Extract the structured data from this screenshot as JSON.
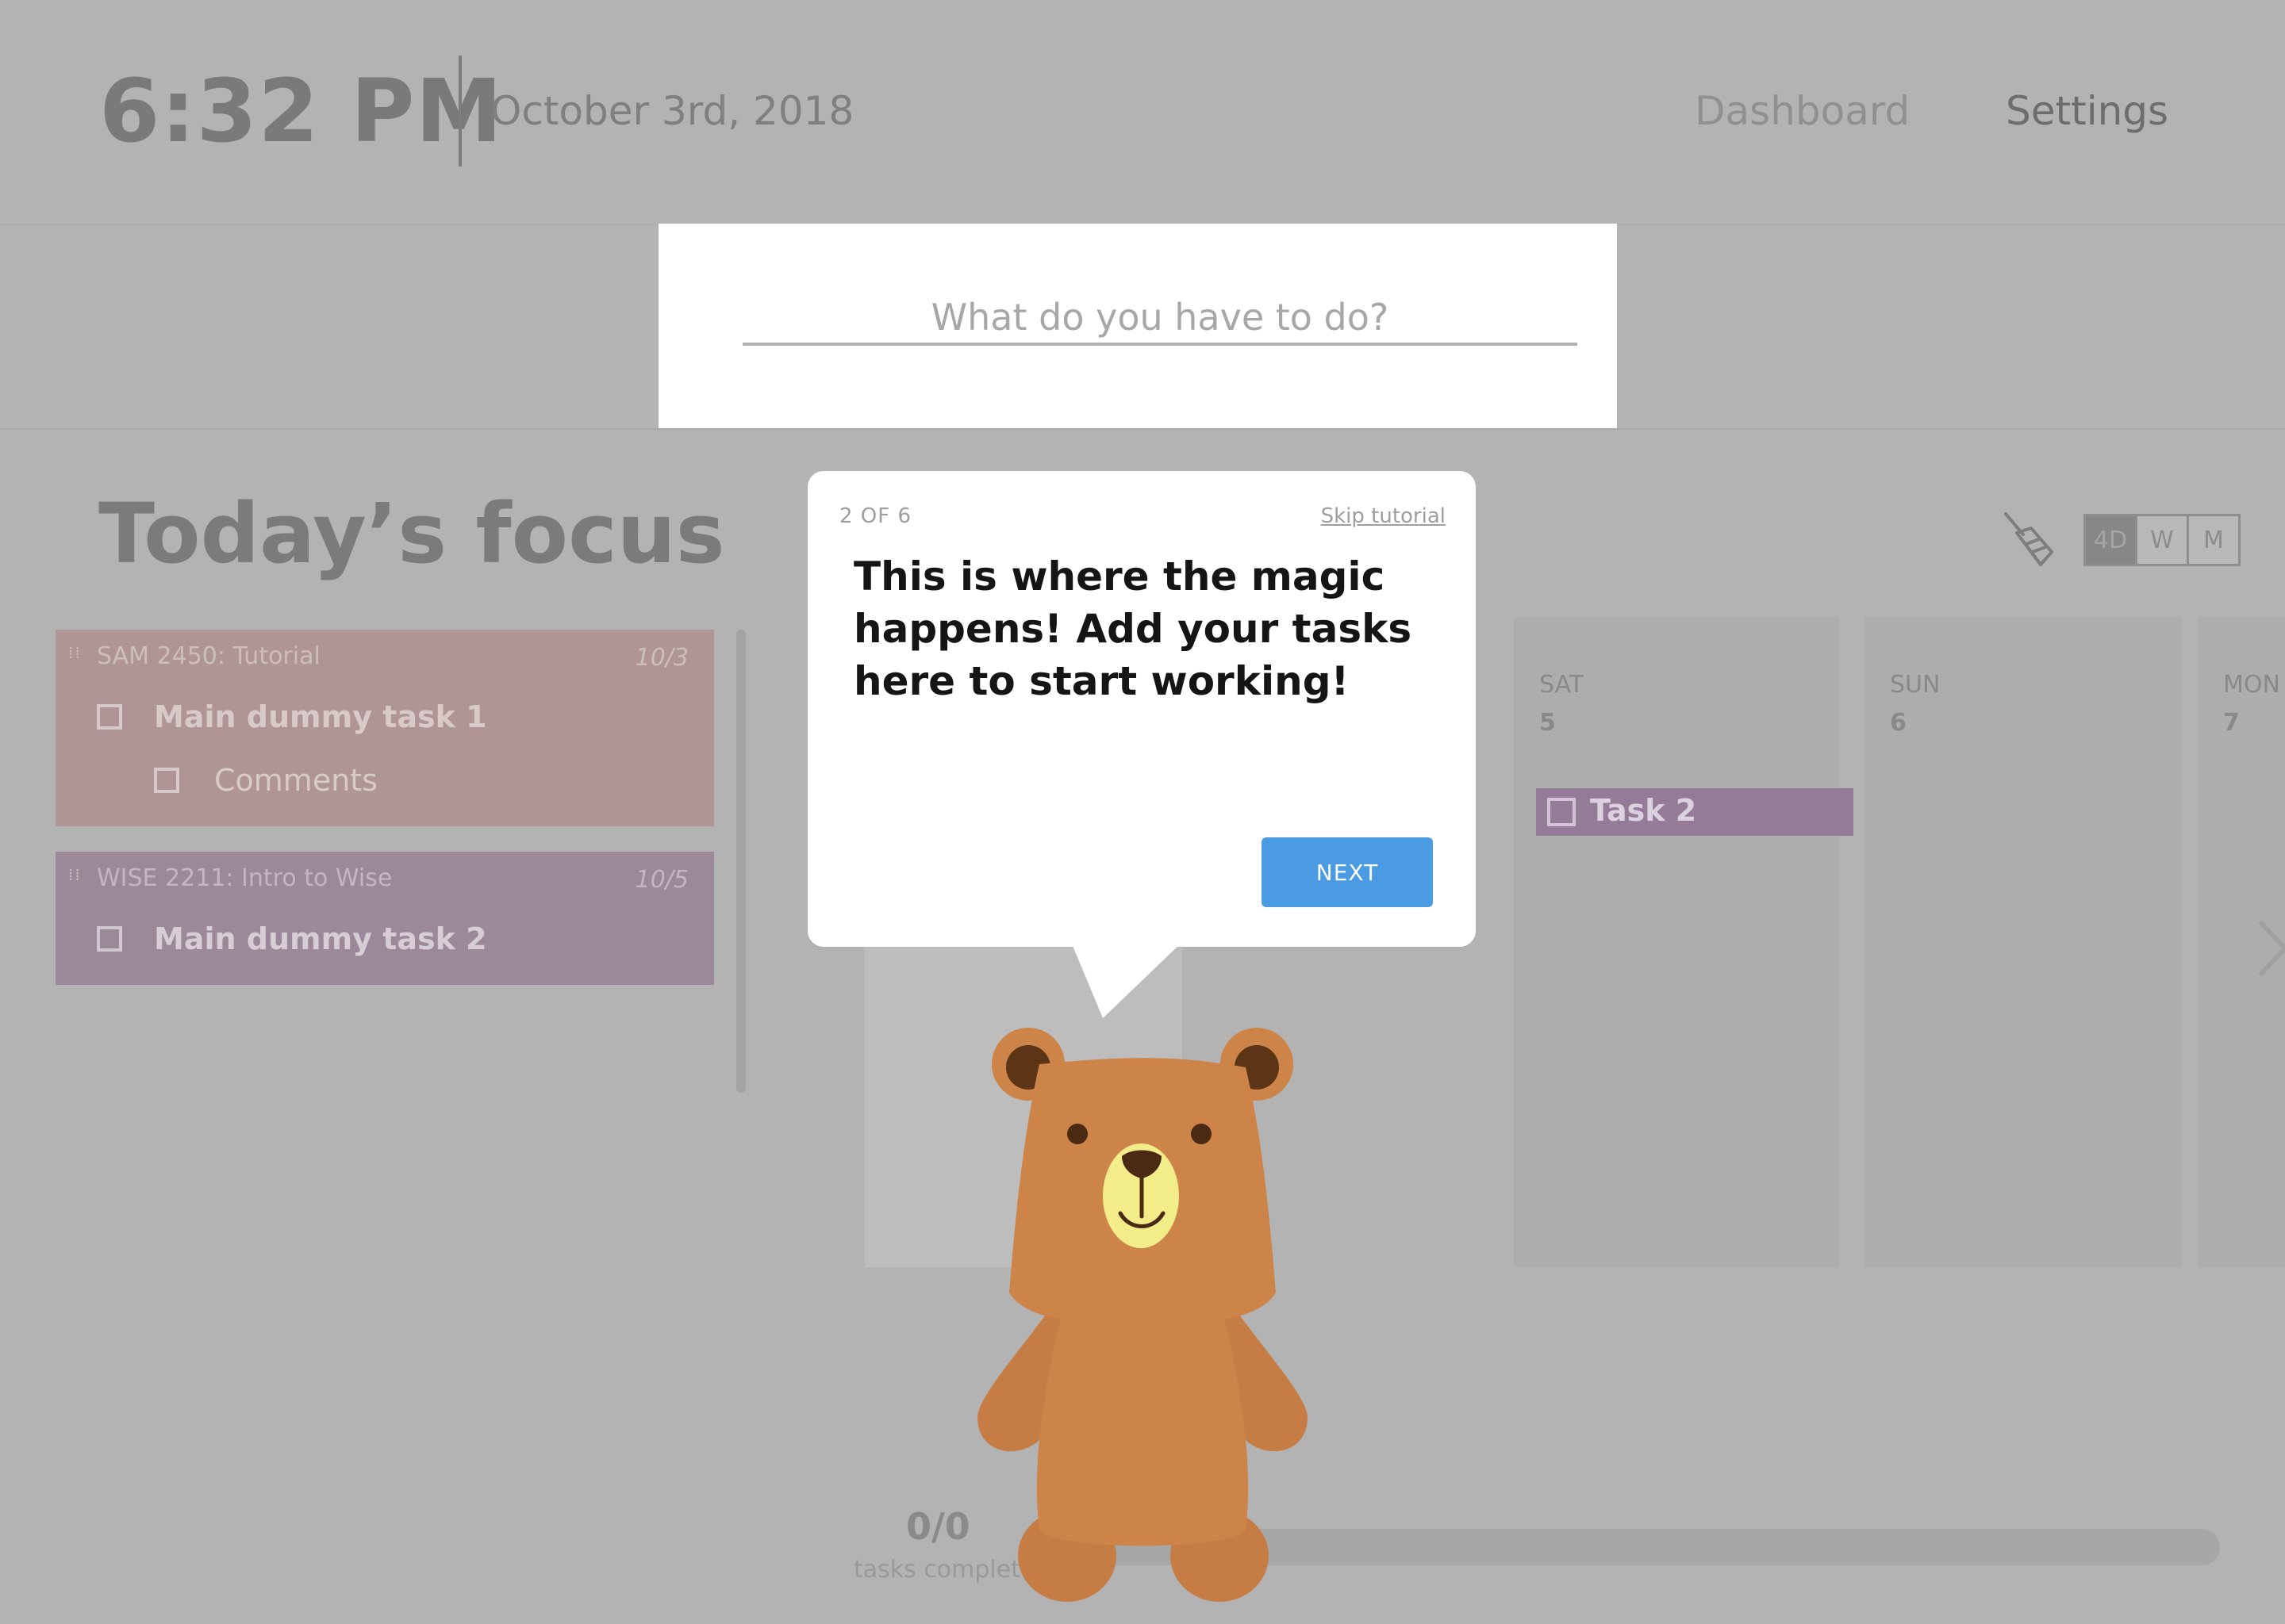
{
  "header": {
    "time": "6:32 PM",
    "date": "October 3rd, 2018",
    "nav": [
      {
        "label": "Dashboard"
      },
      {
        "label": "Settings"
      }
    ]
  },
  "task_input": {
    "placeholder": "What do you have to do?",
    "value": ""
  },
  "focus": {
    "title": "Today’s focus",
    "cards": [
      {
        "course": "SAM 2450: Tutorial",
        "due": "10/3",
        "task": "Main dummy task 1",
        "subtask": "Comments",
        "color": "#b09596"
      },
      {
        "course": "WISE 2211: Intro to Wise",
        "due": "10/5",
        "task": "Main dummy task 2",
        "color": "#9b8898"
      }
    ]
  },
  "view_toggle": {
    "options": [
      {
        "label": "4D",
        "active": true
      },
      {
        "label": "W",
        "active": false
      },
      {
        "label": "M",
        "active": false
      }
    ],
    "clear_icon": "broom-icon"
  },
  "calendar": {
    "days": [
      {
        "name": "SAT",
        "number": "5"
      },
      {
        "name": "SUN",
        "number": "6"
      },
      {
        "name": "MON",
        "number": "7"
      }
    ],
    "tasks": [
      {
        "day": "SAT",
        "label": "Task 2",
        "color": "#947b98"
      }
    ],
    "next_icon": "chevron-right-icon"
  },
  "progress": {
    "count": "0/0",
    "caption": "tasks complete",
    "completed": 0,
    "total": 0
  },
  "tutorial": {
    "step": "2 OF 6",
    "skip_label": "Skip tutorial",
    "message": "This is where the magic happens! Add your tasks here to start working!",
    "next_label": "NEXT",
    "mascot": "bear-mascot",
    "button_color": "#4a9be2"
  }
}
